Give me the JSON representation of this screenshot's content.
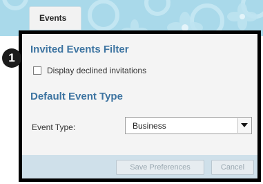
{
  "tabs": [
    {
      "label": "Events"
    }
  ],
  "invited_filter": {
    "title": "Invited Events Filter",
    "checkbox_label": "Display declined invitations",
    "checked": false
  },
  "default_event_type": {
    "title": "Default Event Type",
    "field_label": "Event Type:",
    "selected_value": "Business"
  },
  "footer": {
    "save_label": "Save Preferences",
    "cancel_label": "Cancel"
  },
  "annotation": {
    "step_number": "1"
  },
  "colors": {
    "header_band": "#a9d9ea",
    "section_title": "#3d74a1",
    "panel_background": "#f4f4f4",
    "footer_background": "#cfe0ea",
    "highlight_border": "#000000"
  },
  "icons": {
    "dropdown": "chevron-down-icon",
    "background_pattern": "flower-pattern"
  }
}
